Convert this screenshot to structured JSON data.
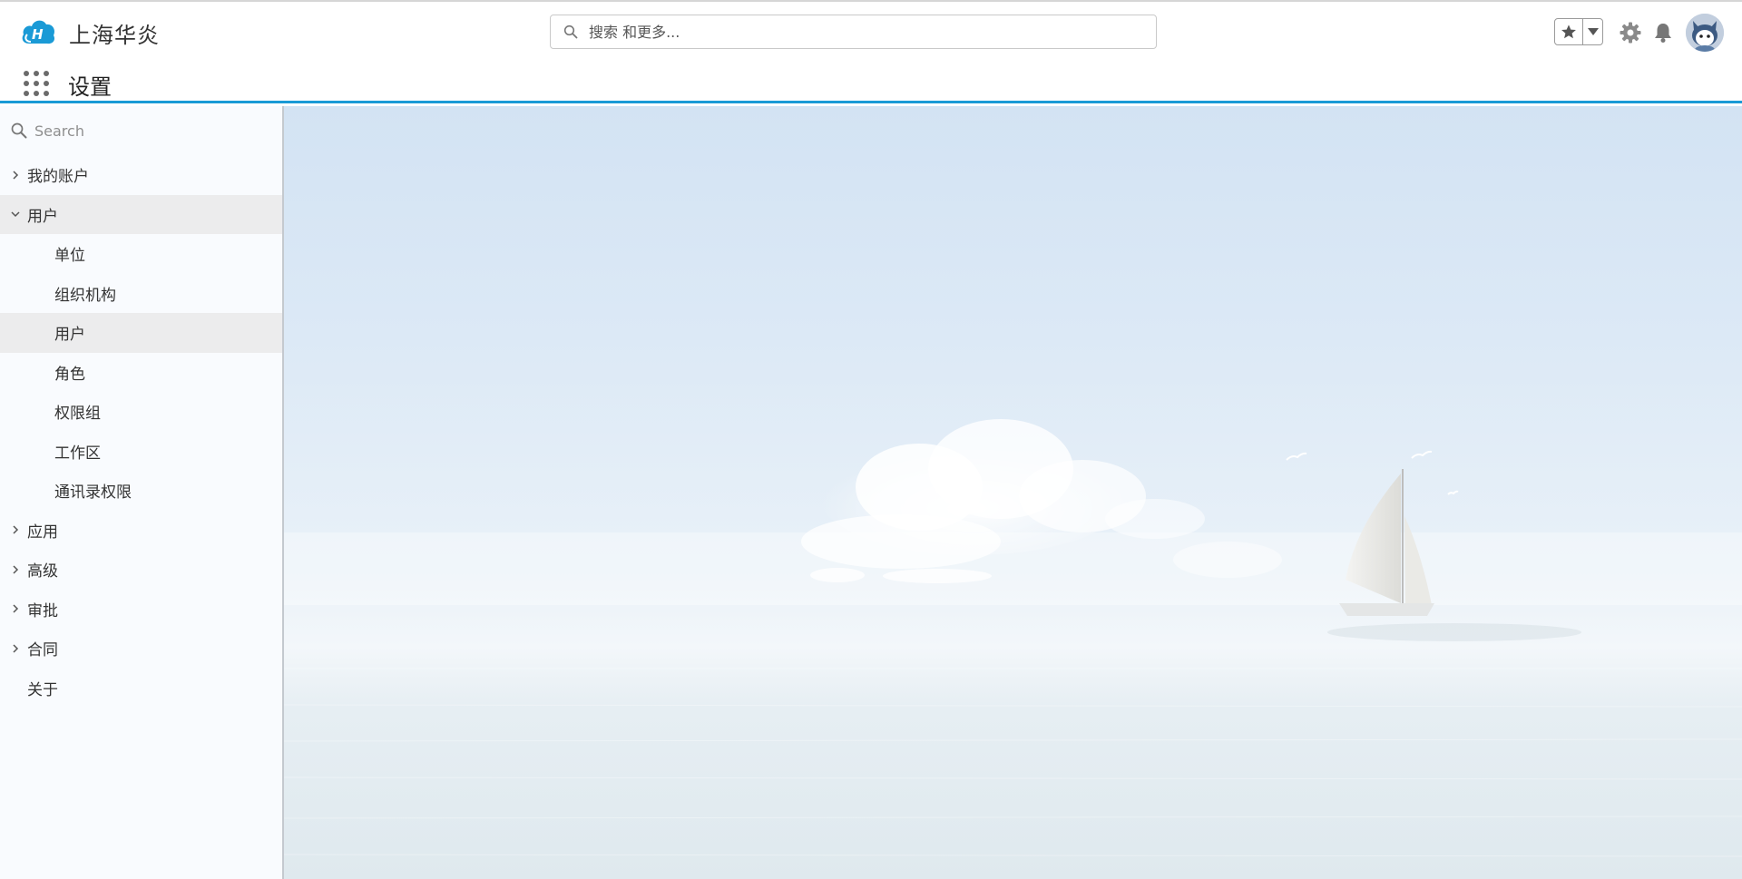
{
  "header": {
    "brand_name": "上海华炎",
    "search_placeholder": "搜索 和更多...",
    "page_title": "设置"
  },
  "sidebar": {
    "search_placeholder": "Search",
    "items": [
      {
        "label": "我的账户",
        "expanded": false,
        "level": 0
      },
      {
        "label": "用户",
        "expanded": true,
        "level": 0
      },
      {
        "label": "单位",
        "level": 1
      },
      {
        "label": "组织机构",
        "level": 1
      },
      {
        "label": "用户",
        "level": 1,
        "selected": true
      },
      {
        "label": "角色",
        "level": 1
      },
      {
        "label": "权限组",
        "level": 1
      },
      {
        "label": "工作区",
        "level": 1
      },
      {
        "label": "通讯录权限",
        "level": 1
      },
      {
        "label": "应用",
        "expanded": false,
        "level": 0
      },
      {
        "label": "高级",
        "expanded": false,
        "level": 0
      },
      {
        "label": "审批",
        "expanded": false,
        "level": 0
      },
      {
        "label": "合同",
        "expanded": false,
        "level": 0
      },
      {
        "label": "关于",
        "level": 0,
        "no_children": true
      }
    ]
  },
  "icons": {
    "brand": "cloud-h-logo-icon",
    "search": "search-icon",
    "favorite": "star-icon",
    "favorite_menu": "caret-down-icon",
    "settings": "gear-icon",
    "notifications": "bell-icon",
    "app_launcher": "grid-icon",
    "user": "avatar"
  },
  "colors": {
    "accent": "#1a9ad6",
    "sidebar_bg": "#f9fbfe",
    "selected_bg": "#ececed"
  }
}
